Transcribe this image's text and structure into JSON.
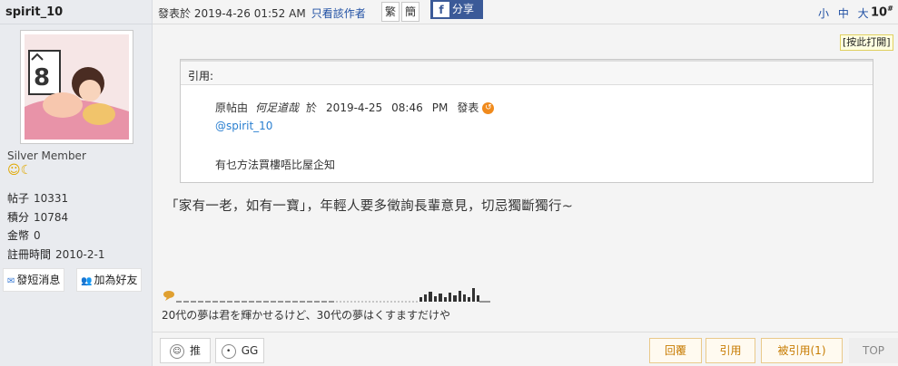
{
  "user": {
    "name": "spirit_10",
    "rank": "Silver Member",
    "stats": [
      {
        "key": "帖子",
        "value": "10331"
      },
      {
        "key": "積分",
        "value": "10784"
      },
      {
        "key": "金幣",
        "value": "0"
      },
      {
        "key": "註冊時間",
        "value": "2010-2-1"
      }
    ],
    "pm_label": "發短消息",
    "friend_label": "加為好友"
  },
  "post": {
    "posted_text": "發表於 2019-4-26 01:52 AM",
    "only_author": "只看該作者",
    "trad": "繁",
    "simp": "簡",
    "share": "分享",
    "font_size": "小 中 大",
    "floor": "10",
    "floor_mark": "#",
    "print": "[按此打開]",
    "content": "「家有一老，如有一寶」，年輕人要多徵詢長輩意見，切忌獨斷獨行~",
    "signature": "20代の夢は君を輝かせるけど、30代の夢はくすますだけや"
  },
  "quote": {
    "header": "引用:",
    "origin_label": "原帖由",
    "author": "何足道哉",
    "at": "於",
    "date": "2019-4-25",
    "time": "08:46",
    "ampm": "PM",
    "posted": "發表",
    "mention": "@spirit_10",
    "text": "有乜方法買樓唔比屋企知"
  },
  "actions": {
    "push": "推",
    "gg": "GG",
    "reply": "回覆",
    "quote": "引用",
    "quoted": "被引用(1)",
    "top": "TOP"
  },
  "colors": {
    "link": "#1f4fa3",
    "facebook": "#3b5a98",
    "action_orange": "#c77b00",
    "mention": "#2a7fd0"
  }
}
